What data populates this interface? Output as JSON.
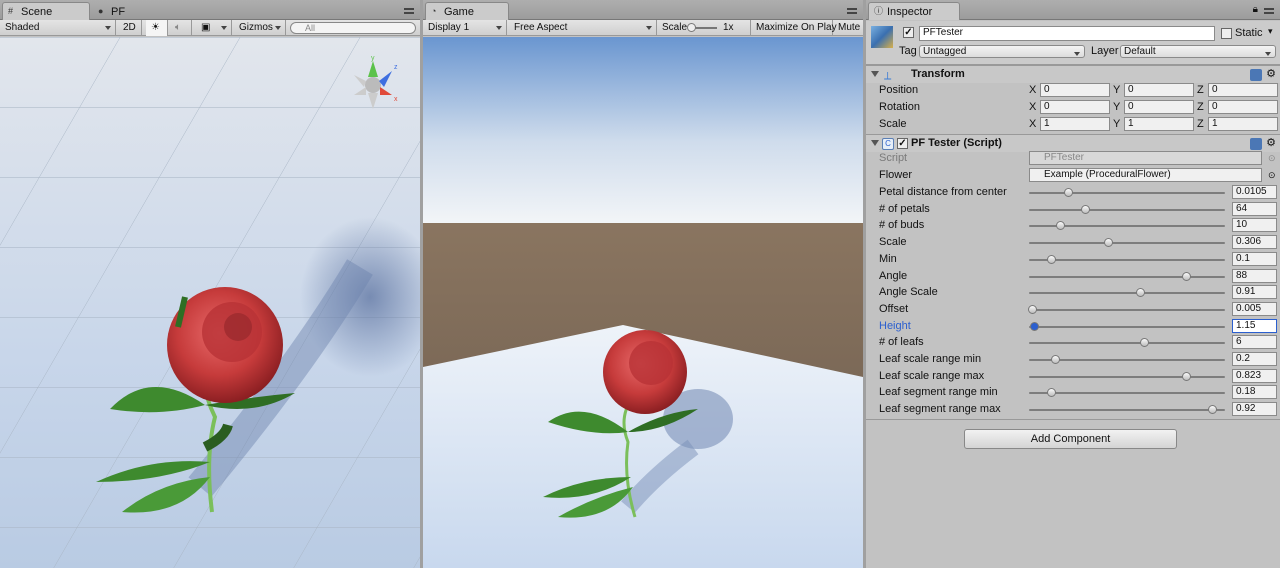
{
  "scene": {
    "tabs": [
      "Scene",
      "PF"
    ],
    "toolbar": {
      "shading": "Shaded",
      "mode2d": "2D",
      "gizmos": "Gizmos",
      "search_placeholder": "All"
    },
    "gizmo_axes": [
      "y",
      "z",
      "x"
    ]
  },
  "game": {
    "tab": "Game",
    "toolbar": {
      "display": "Display 1",
      "aspect": "Free Aspect",
      "scale_label": "Scale",
      "scale_value": "1x",
      "maximize": "Maximize On Play",
      "mute": "Mute"
    }
  },
  "inspector": {
    "tab": "Inspector",
    "object_name": "PFTester",
    "static_label": "Static",
    "tag_label": "Tag",
    "tag_value": "Untagged",
    "layer_label": "Layer",
    "layer_value": "Default",
    "transform": {
      "title": "Transform",
      "rows": [
        {
          "label": "Position",
          "x": "0",
          "y": "0",
          "z": "0"
        },
        {
          "label": "Rotation",
          "x": "0",
          "y": "0",
          "z": "0"
        },
        {
          "label": "Scale",
          "x": "1",
          "y": "1",
          "z": "1"
        }
      ]
    },
    "script_comp": {
      "title": "PF Tester (Script)",
      "script_label": "Script",
      "script_value": "PFTester",
      "flower_label": "Flower",
      "flower_value": "Example (ProceduralFlower)",
      "sliders": [
        {
          "label": "Petal distance from center",
          "value": "0.0105",
          "fraction": 0.2
        },
        {
          "label": "# of petals",
          "value": "64",
          "fraction": 0.29
        },
        {
          "label": "# of buds",
          "value": "10",
          "fraction": 0.16
        },
        {
          "label": "Scale",
          "value": "0.306",
          "fraction": 0.41
        },
        {
          "label": "Min",
          "value": "0.1",
          "fraction": 0.11
        },
        {
          "label": "Angle",
          "value": "88",
          "fraction": 0.82
        },
        {
          "label": "Angle Scale",
          "value": "0.91",
          "fraction": 0.58
        },
        {
          "label": "Offset",
          "value": "0.005",
          "fraction": 0.01
        },
        {
          "label": "Height",
          "value": "1.15",
          "fraction": 0.02,
          "active": true
        },
        {
          "label": "# of leafs",
          "value": "6",
          "fraction": 0.6
        },
        {
          "label": "Leaf scale range min",
          "value": "0.2",
          "fraction": 0.13
        },
        {
          "label": "Leaf scale range max",
          "value": "0.823",
          "fraction": 0.82
        },
        {
          "label": "Leaf segment range min",
          "value": "0.18",
          "fraction": 0.11
        },
        {
          "label": "Leaf segment range max",
          "value": "0.92",
          "fraction": 0.96
        }
      ]
    },
    "add_component": "Add Component"
  },
  "colors": {
    "accent_blue": "#2b5fcf",
    "panel": "#c2c2c2",
    "sky_top": "#6a96d0",
    "ground": "#8a7560"
  }
}
